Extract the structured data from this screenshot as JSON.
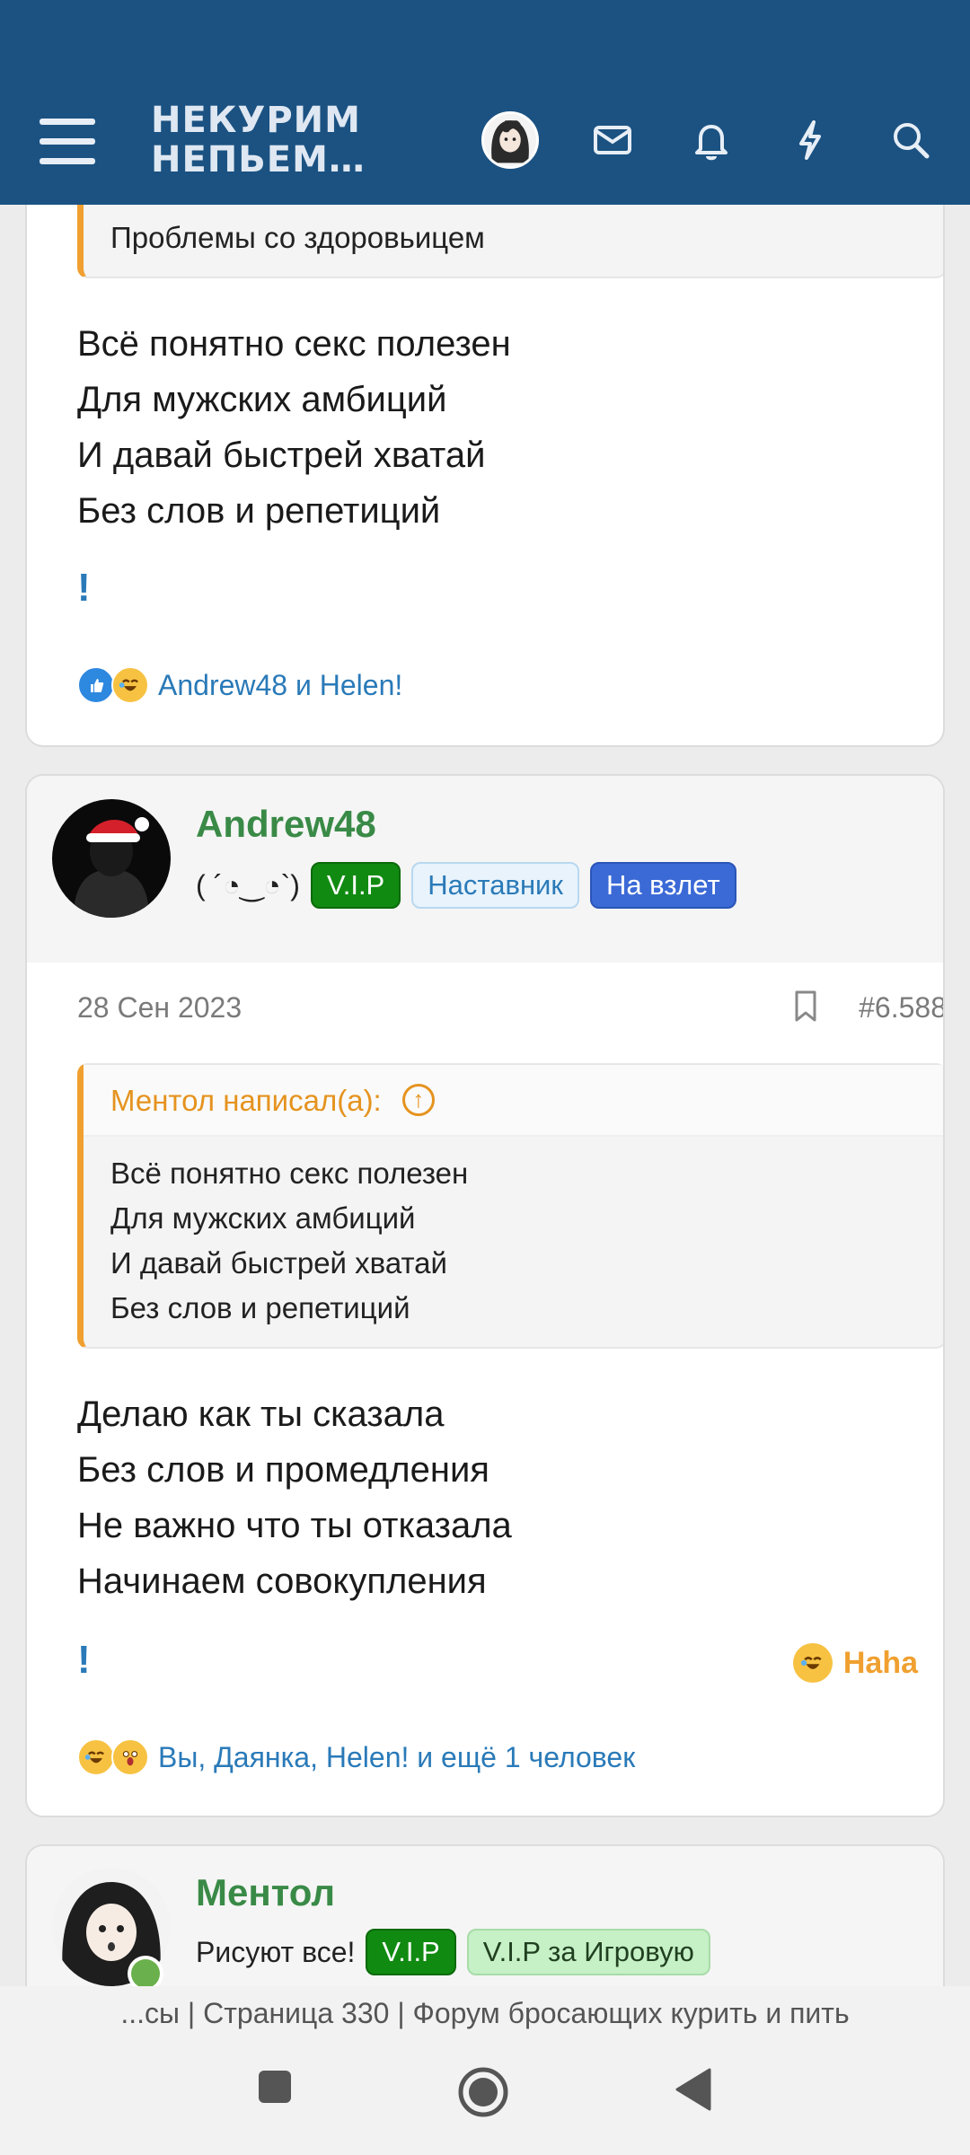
{
  "header": {
    "logo_line1": "НЕКУРИМ",
    "logo_line2": "НЕПЬЕМ…",
    "accent": "#1b5282"
  },
  "post1": {
    "quote_partial": "Проблемы со здоровьицем",
    "body": [
      "Всё понятно секс полезен",
      "Для мужских амбиций",
      "И давай быстрей хватай",
      "Без слов и репетиций"
    ],
    "excl": "!",
    "reactions_text": "Andrew48 и Helen!"
  },
  "post2": {
    "username": "Andrew48",
    "status": "( ´◔‿◔`)",
    "badges": [
      "V.I.P",
      "Наставник",
      "На взлет"
    ],
    "date": "28 Сен 2023",
    "post_number": "#6.588",
    "quote_author": "Ментол написал(а):",
    "quote_lines": [
      "Всё понятно секс полезен",
      "Для мужских амбиций",
      "И давай быстрей хватай",
      "Без слов и репетиций"
    ],
    "body": [
      "Делаю как ты сказала",
      "Без слов и промедления",
      "Не важно что ты отказала",
      "Начинаем совокупления"
    ],
    "excl": "!",
    "haha_label": "Haha",
    "reactions_text": "Вы, Даянка, Helen! и ещё 1 человек"
  },
  "post3": {
    "username": "Ментол",
    "status": "Рисуют все!",
    "badges": [
      "V.I.P",
      "V.I.P за Игровую"
    ]
  },
  "url_bar": "...сы | Страница 330 | Форум бросающих курить и пить"
}
